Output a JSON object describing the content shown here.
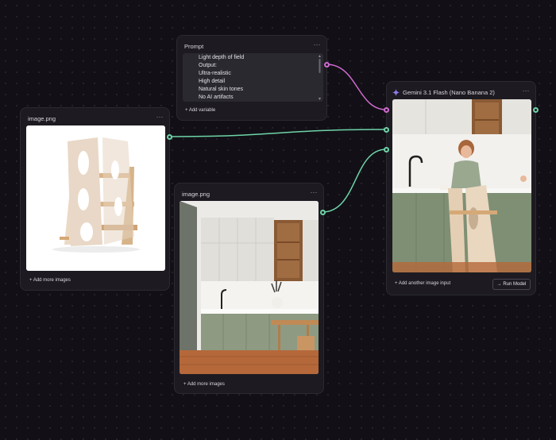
{
  "nodes": {
    "image1": {
      "title": "image.png",
      "add_label": "+ Add more images"
    },
    "prompt": {
      "title": "Prompt",
      "lines": [
        "Light depth of field",
        "Output:",
        "Ultra-realistic",
        "High detail",
        "Natural skin tones",
        "No AI artifacts"
      ],
      "add_variable": "+ Add variable"
    },
    "image2": {
      "title": "image.png",
      "add_label": "+ Add more images"
    },
    "model": {
      "title": "Gemini 3.1 Flash (Nano Banana 2)",
      "add_input": "+ Add another image input",
      "run_label": "→ Run Model",
      "sparkle_icon": "sparkle-icon"
    }
  },
  "menu_glyph": "⋯",
  "colors": {
    "canvas": "#121016",
    "node": "#1d1b21",
    "wire_green": "#6ed4a8",
    "wire_pink": "#d06ad0",
    "sparkle": "#8b7be8"
  }
}
